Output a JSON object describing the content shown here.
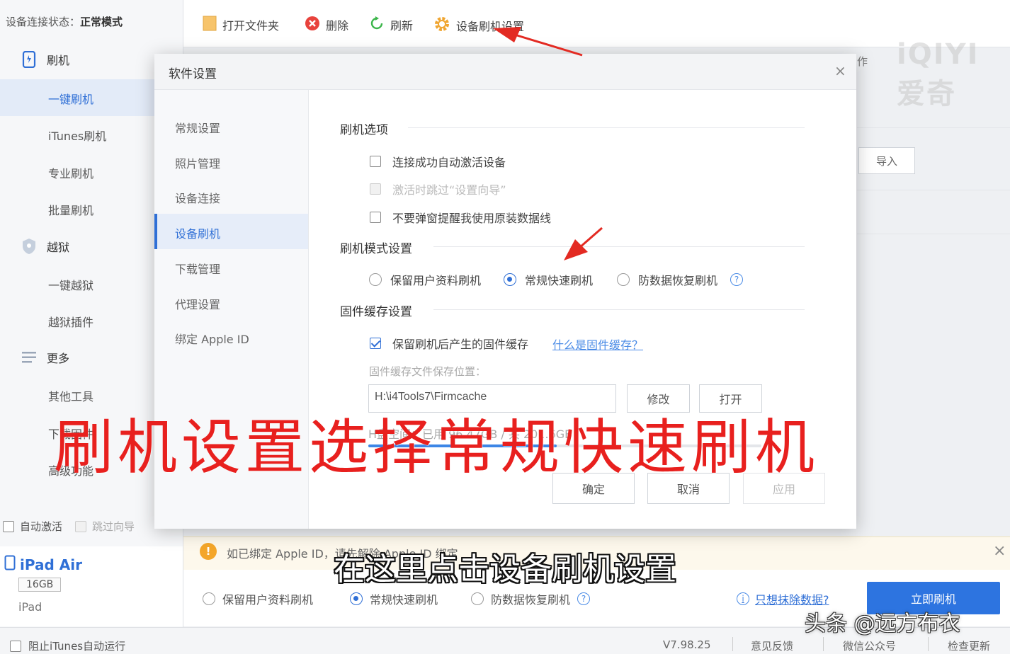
{
  "sidebar": {
    "conn_label": "设备连接状态：",
    "conn_value": "正常模式",
    "sections": {
      "flash": "刷机",
      "jailbreak": "越狱",
      "more": "更多"
    },
    "flash_items": [
      "一键刷机",
      "iTunes刷机",
      "专业刷机",
      "批量刷机"
    ],
    "jailbreak_items": [
      "一键越狱",
      "越狱插件"
    ],
    "more_items": [
      "其他工具",
      "下载固件",
      "高级功能"
    ],
    "auto_activate": "自动激活",
    "skip_guide": "跳过向导",
    "device": {
      "name": "iPad Air",
      "capacity": "16GB",
      "type": "iPad"
    }
  },
  "toolbar": {
    "open_folder": "打开文件夹",
    "delete": "删除",
    "refresh": "刷新",
    "flash_settings": "设备刷机设置",
    "bg_header": "作",
    "import": "导入"
  },
  "modal": {
    "title": "软件设置",
    "close": "×",
    "nav": [
      "常规设置",
      "照片管理",
      "设备连接",
      "设备刷机",
      "下载管理",
      "代理设置",
      "绑定 Apple ID"
    ],
    "flash_options": {
      "title": "刷机选项",
      "items": [
        "连接成功自动激活设备",
        "激活时跳过“设置向导”",
        "不要弹窗提醒我使用原装数据线"
      ]
    },
    "flash_mode": {
      "title": "刷机模式设置",
      "options": [
        "保留用户资料刷机",
        "常规快速刷机",
        "防数据恢复刷机"
      ],
      "selected": "常规快速刷机"
    },
    "firmware_cache": {
      "title": "固件缓存设置",
      "keep_cache": "保留刷机后产生的固件缓存",
      "what_link": "什么是固件缓存？",
      "location_label": "固件缓存文件保存位置：",
      "path": "H:\\i4Tools7\\Firmcache",
      "modify": "修改",
      "open": "打开",
      "disk_info": "H盘空间：已用 96.47GB / 共 201.6GB",
      "disk_used_fraction": 0.48
    },
    "buttons": {
      "ok": "确定",
      "cancel": "取消",
      "apply": "应用"
    }
  },
  "notice": {
    "text": "如已绑定 Apple ID，请先解除 Apple ID 绑定",
    "close": "×"
  },
  "mode_bar": {
    "options": [
      "保留用户资料刷机",
      "常规快速刷机",
      "防数据恢复刷机"
    ],
    "selected": "常规快速刷机",
    "erase_link": "只想抹除数据?",
    "flash_now": "立即刷机"
  },
  "status_bar": {
    "itunes": "阻止iTunes自动运行",
    "version": "V7.98.25",
    "feedback": "意见反馈",
    "wechat": "微信公众号",
    "update": "检查更新"
  },
  "overlay": {
    "watermark": "iQIYI 爱奇",
    "caption": "刷机设置选择常规快速刷机",
    "subtitle": "在这里点击设备刷机设置",
    "source": "头条 @远方布衣"
  },
  "colors": {
    "accent": "#2f6fd6",
    "caption_red": "#e8201e",
    "flash_button": "#2d74e0"
  }
}
